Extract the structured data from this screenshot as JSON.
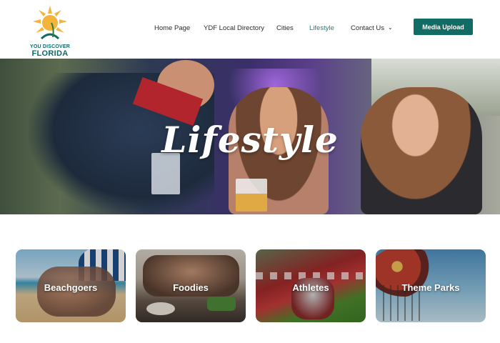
{
  "brand": {
    "logo_line1": "YOU DISCOVER",
    "logo_line2": "FLORIDA",
    "colors": {
      "primary": "#106c64",
      "sun": "#f4b33a",
      "text": "#2b2b2b",
      "active_link": "#1f7f7e"
    }
  },
  "nav": {
    "items": [
      {
        "label": "Home Page",
        "active": false
      },
      {
        "label": "YDF Local Directory",
        "active": false
      },
      {
        "label": "Cities",
        "active": false
      },
      {
        "label": "Lifestyle",
        "active": true
      },
      {
        "label": "Contact Us",
        "active": false,
        "dropdown": true
      }
    ],
    "cta_label": "Media Upload"
  },
  "hero": {
    "title": "Lifestyle"
  },
  "categories": [
    {
      "label": "Beachgoers",
      "icon": "beach-photo"
    },
    {
      "label": "Foodies",
      "icon": "food-photo"
    },
    {
      "label": "Athletes",
      "icon": "football-photo"
    },
    {
      "label": "Theme Parks",
      "icon": "ride-photo"
    }
  ]
}
